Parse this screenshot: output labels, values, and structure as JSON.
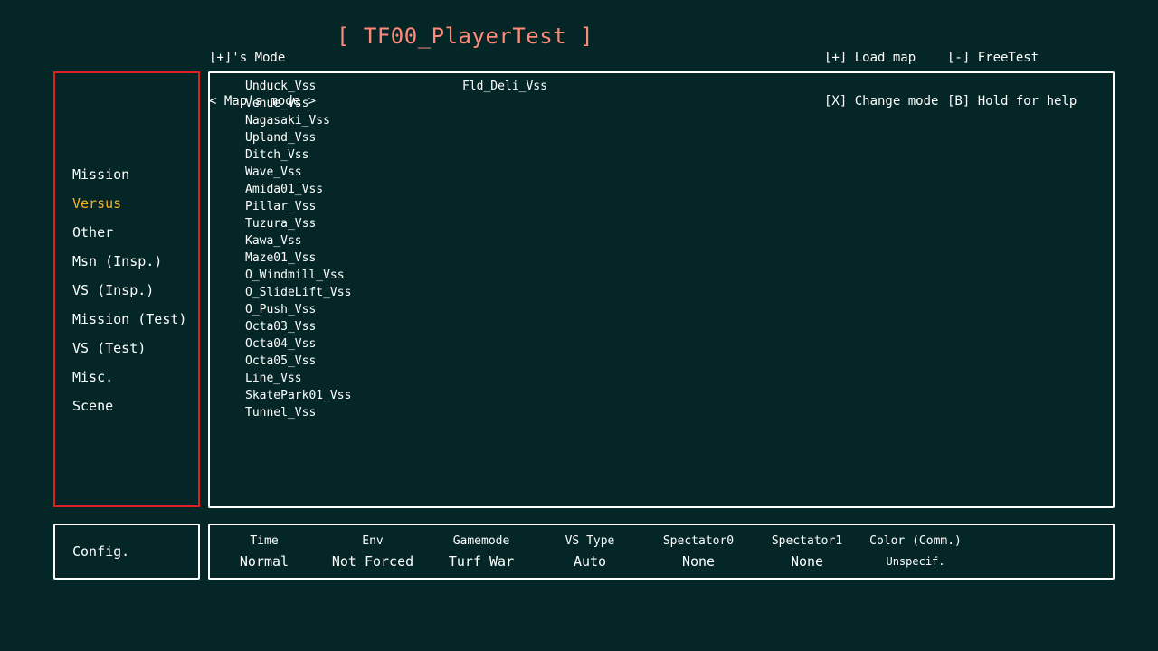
{
  "header": {
    "mode_line1": "[+]'s Mode",
    "mode_line2": "< Map's mode >",
    "title": "[ TF00_PlayerTest ]",
    "help_left": [
      "[+] Load map",
      "[X] Change mode"
    ],
    "help_right": [
      "[-] FreeTest",
      "[B] Hold for help"
    ],
    "title_color": "#ff8a7a"
  },
  "sidebar": {
    "items": [
      {
        "label": "Mission"
      },
      {
        "label": "Versus",
        "selected": true
      },
      {
        "label": "Other"
      },
      {
        "label": "Msn (Insp.)"
      },
      {
        "label": "VS (Insp.)"
      },
      {
        "label": "Mission (Test)"
      },
      {
        "label": "VS (Test)"
      },
      {
        "label": "Misc."
      },
      {
        "label": "Scene"
      }
    ],
    "selected_color": "#ffb020",
    "border_color": "#e0201c"
  },
  "maps": {
    "col1": [
      "Unduck_Vss",
      "Venue_Vss",
      "Nagasaki_Vss",
      "Upland_Vss",
      "Ditch_Vss",
      "Wave_Vss",
      "Amida01_Vss",
      "Pillar_Vss",
      "Tuzura_Vss",
      "Kawa_Vss",
      "Maze01_Vss",
      "O_Windmill_Vss",
      "O_SlideLift_Vss",
      "O_Push_Vss",
      "Octa03_Vss",
      "Octa04_Vss",
      "Octa05_Vss",
      "Line_Vss",
      "SkatePark01_Vss",
      "Tunnel_Vss"
    ],
    "col2": [
      "Fld_Deli_Vss"
    ]
  },
  "config": {
    "label": "Config.",
    "settings": [
      {
        "label": "Time",
        "value": "Normal"
      },
      {
        "label": "Env",
        "value": "Not Forced"
      },
      {
        "label": "Gamemode",
        "value": "Turf War"
      },
      {
        "label": "VS Type",
        "value": "Auto"
      },
      {
        "label": "Spectator0",
        "value": "None"
      },
      {
        "label": "Spectator1",
        "value": "None"
      },
      {
        "label": "Color (Comm.)",
        "value": "Unspecif."
      }
    ]
  },
  "colors": {
    "background": "#042626",
    "text": "#ffffff"
  }
}
